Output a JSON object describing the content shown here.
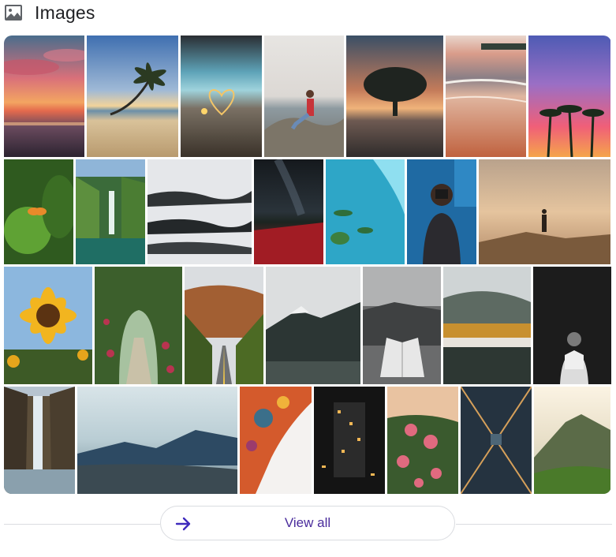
{
  "section": {
    "title": "Images",
    "icon": "image-icon"
  },
  "images": [
    {
      "subject": "sunset-beach-clouds"
    },
    {
      "subject": "palm-tree-beach"
    },
    {
      "subject": "heart-sparkler-bokeh"
    },
    {
      "subject": "woman-sitting-on-rocks"
    },
    {
      "subject": "tree-silhouette-sunset"
    },
    {
      "subject": "beach-waves-sunset"
    },
    {
      "subject": "palm-trees-purple-sky"
    },
    {
      "subject": "butterfly-on-leaves"
    },
    {
      "subject": "waterfall-green-lake"
    },
    {
      "subject": "misty-forest-layers"
    },
    {
      "subject": "night-sky-red-road"
    },
    {
      "subject": "aerial-turquoise-islands"
    },
    {
      "subject": "photographer-with-camera"
    },
    {
      "subject": "person-above-clouds"
    },
    {
      "subject": "sunflower"
    },
    {
      "subject": "flower-arch-garden"
    },
    {
      "subject": "autumn-road"
    },
    {
      "subject": "foggy-mountains-lake"
    },
    {
      "subject": "open-book-mountains"
    },
    {
      "subject": "autumn-forest-reflection"
    },
    {
      "subject": "woman-dark-portrait"
    },
    {
      "subject": "waterfall-cliffs"
    },
    {
      "subject": "mountain-lake-valley"
    },
    {
      "subject": "floral-fractal-art"
    },
    {
      "subject": "city-night-aerial"
    },
    {
      "subject": "pink-roses"
    },
    {
      "subject": "city-aerial-skyscrapers"
    },
    {
      "subject": "misty-green-mountains"
    }
  ],
  "view_all": {
    "label": "View all",
    "icon": "arrow-right-icon"
  }
}
